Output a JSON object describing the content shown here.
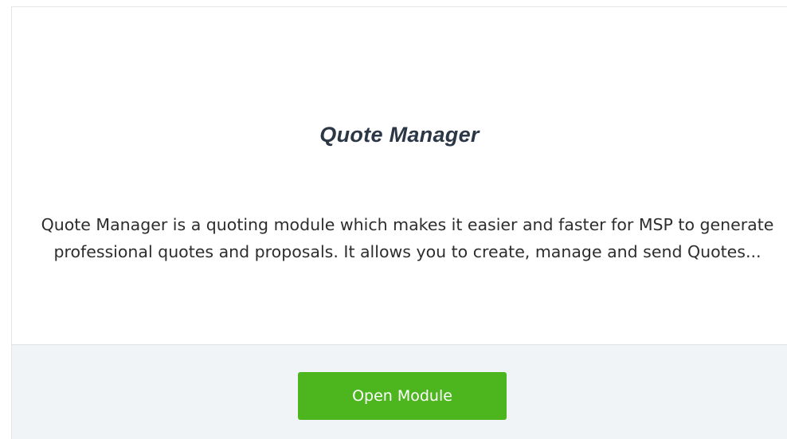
{
  "module_card": {
    "logo_text": "Quote Manager",
    "description": "Quote Manager is a quoting module which makes it easier and faster for MSP to generate professional quotes and proposals. It allows you to create, manage and send Quotes...",
    "open_button_label": "Open Module"
  },
  "colors": {
    "logo_text": "#2b3746",
    "logo_accent": "#d7262d",
    "button_bg": "#4db61f",
    "footer_bg": "#f1f4f7"
  }
}
